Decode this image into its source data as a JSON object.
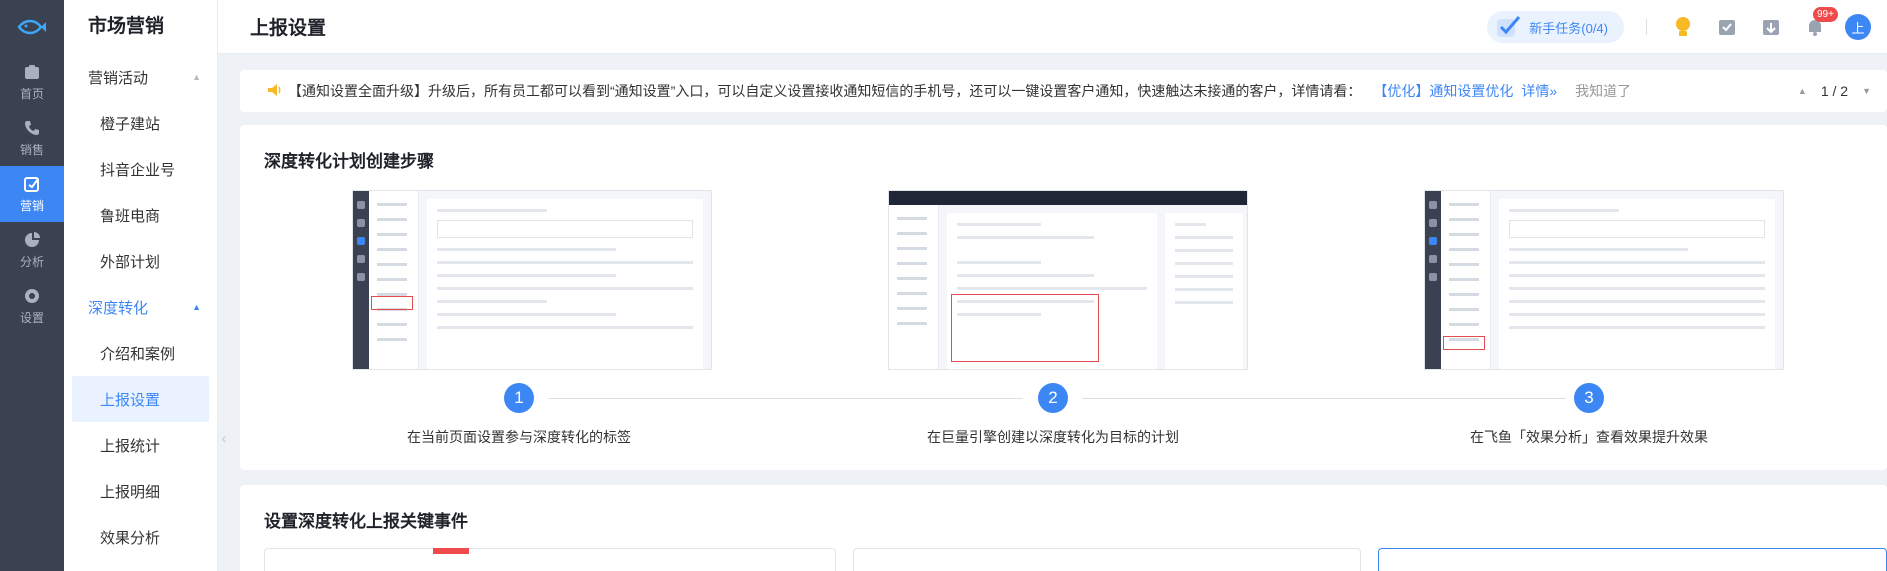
{
  "rail": {
    "items": [
      {
        "label": "首页",
        "icon": "home-icon"
      },
      {
        "label": "销售",
        "icon": "phone-icon"
      },
      {
        "label": "营销",
        "icon": "marketing-icon",
        "active": true
      },
      {
        "label": "分析",
        "icon": "analysis-icon"
      },
      {
        "label": "设置",
        "icon": "gear-icon"
      }
    ]
  },
  "sidebar": {
    "title": "市场营销",
    "group1": "营销活动",
    "group1_items": [
      "橙子建站",
      "抖音企业号",
      "鲁班电商",
      "外部计划"
    ],
    "group2": "深度转化",
    "group2_items": [
      "介绍和案例",
      "上报设置",
      "上报统计",
      "上报明细",
      "效果分析"
    ],
    "active_item": "上报设置"
  },
  "header": {
    "title": "上报设置",
    "task_label": "新手任务(0/4)",
    "notification_badge": "99+",
    "avatar_text": "上"
  },
  "notice": {
    "text": "【通知设置全面升级】升级后，所有员工都可以看到“通知设置”入口，可以自定义设置接收通知短信的手机号，还可以一键设置客户通知，快速触达未接通的客户，详情请看：",
    "link": "【优化】通知设置优化",
    "detail": "详情»",
    "dismiss": "我知道了",
    "pager": "1 / 2"
  },
  "steps_card": {
    "title": "深度转化计划创建步骤",
    "steps": [
      {
        "num": "1",
        "label": "在当前页面设置参与深度转化的标签"
      },
      {
        "num": "2",
        "label": "在巨量引擎创建以深度转化为目标的计划"
      },
      {
        "num": "3",
        "label": "在飞鱼「效果分析」查看效果提升效果"
      }
    ]
  },
  "events_card": {
    "title": "设置深度转化上报关键事件"
  },
  "colors": {
    "accent": "#3d87f5",
    "rail": "#3a4252",
    "badge": "#f04b4b"
  }
}
